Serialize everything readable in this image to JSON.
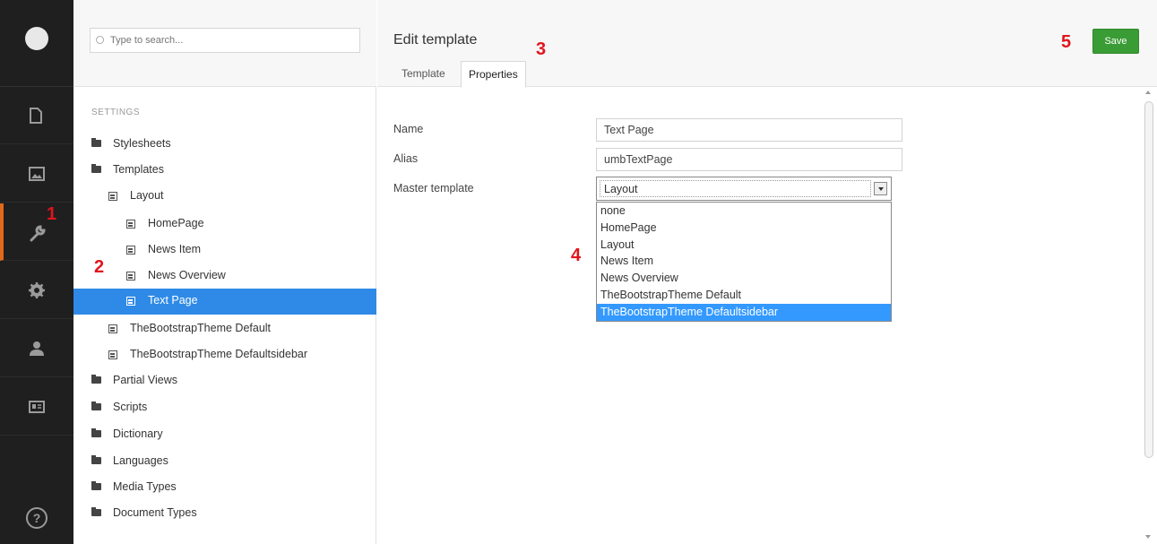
{
  "rail": {
    "items": [
      {
        "icon": "document-icon"
      },
      {
        "icon": "image-icon"
      },
      {
        "icon": "wrench-icon",
        "active": true
      },
      {
        "icon": "gear-icon"
      },
      {
        "icon": "user-icon"
      },
      {
        "icon": "id-card-icon"
      }
    ],
    "help_label": "?",
    "accent_color": "#e06a1a"
  },
  "tree": {
    "search_placeholder": "Type to search...",
    "heading": "SETTINGS",
    "items": [
      {
        "label": "Stylesheets",
        "icon": "folder-icon"
      },
      {
        "label": "Templates",
        "icon": "folder-icon"
      },
      {
        "label": "Layout",
        "icon": "template-icon"
      },
      {
        "label": "HomePage",
        "icon": "template-icon"
      },
      {
        "label": "News Item",
        "icon": "template-icon"
      },
      {
        "label": "News Overview",
        "icon": "template-icon"
      },
      {
        "label": "Text Page",
        "icon": "template-icon",
        "selected": true
      },
      {
        "label": "TheBootstrapTheme Default",
        "icon": "template-icon"
      },
      {
        "label": "TheBootstrapTheme Defaultsidebar",
        "icon": "template-icon"
      },
      {
        "label": "Partial Views",
        "icon": "folder-icon"
      },
      {
        "label": "Scripts",
        "icon": "folder-icon"
      },
      {
        "label": "Dictionary",
        "icon": "folder-icon"
      },
      {
        "label": "Languages",
        "icon": "folder-icon"
      },
      {
        "label": "Media Types",
        "icon": "folder-icon"
      },
      {
        "label": "Document Types",
        "icon": "folder-icon"
      }
    ],
    "selected_color": "#2e8ae6"
  },
  "header": {
    "title": "Edit template",
    "tabs": [
      {
        "label": "Template",
        "active": false
      },
      {
        "label": "Properties",
        "active": true
      }
    ],
    "save_label": "Save",
    "save_color": "#3a9c35"
  },
  "form": {
    "name_label": "Name",
    "name_value": "Text Page",
    "alias_label": "Alias",
    "alias_value": "umbTextPage",
    "master_label": "Master template",
    "master_value": "Layout",
    "master_options": [
      "none",
      "HomePage",
      "Layout",
      "News Item",
      "News Overview",
      "TheBootstrapTheme Default",
      "TheBootstrapTheme Defaultsidebar"
    ],
    "highlighted_option": "TheBootstrapTheme Defaultsidebar"
  },
  "markers": [
    "1",
    "2",
    "3",
    "4",
    "5"
  ],
  "marker_color": "#e0141c"
}
